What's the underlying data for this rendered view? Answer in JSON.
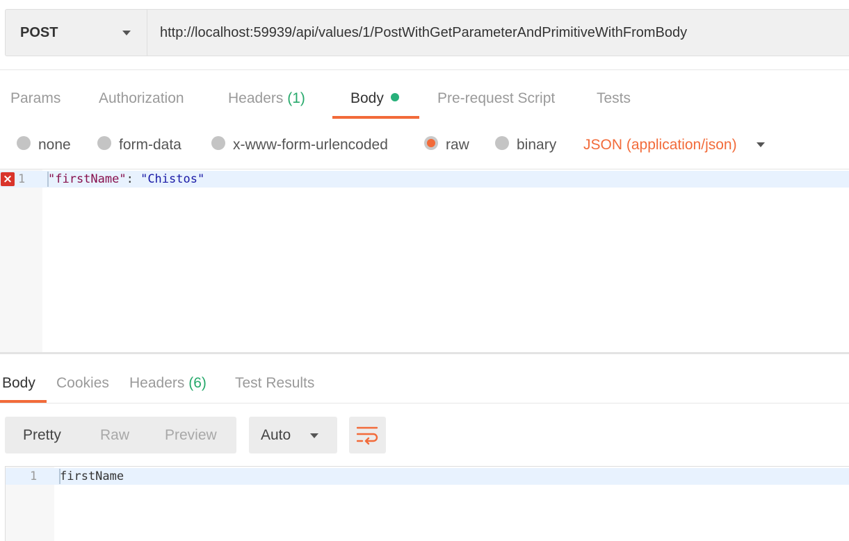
{
  "request": {
    "method": "POST",
    "url": "http://localhost:59939/api/values/1/PostWithGetParameterAndPrimitiveWithFromBody"
  },
  "request_tabs": {
    "params": "Params",
    "authorization": "Authorization",
    "headers": "Headers",
    "headers_count": "(1)",
    "body": "Body",
    "pre_request": "Pre-request Script",
    "tests": "Tests",
    "active": "Body"
  },
  "body_types": {
    "none": "none",
    "form_data": "form-data",
    "urlencoded": "x-www-form-urlencoded",
    "raw": "raw",
    "binary": "binary",
    "selected": "raw",
    "content_type": "JSON (application/json)"
  },
  "editor": {
    "line_number": "1",
    "key": "\"firstName\"",
    "separator": ": ",
    "value": "\"Chistos\"",
    "error_icon": "error-x-icon"
  },
  "response_tabs": {
    "body": "Body",
    "cookies": "Cookies",
    "headers": "Headers",
    "headers_count": "(6)",
    "test_results": "Test Results",
    "active": "Body"
  },
  "response_view": {
    "pretty": "Pretty",
    "raw": "Raw",
    "preview": "Preview",
    "selected": "Pretty",
    "format": "Auto",
    "wrap_icon": "wrap-lines-icon"
  },
  "response_body": {
    "line_number": "1",
    "text": "firstName"
  },
  "colors": {
    "accent": "#f26b3a",
    "count_green": "#27a96b",
    "error_red": "#d9342b"
  }
}
